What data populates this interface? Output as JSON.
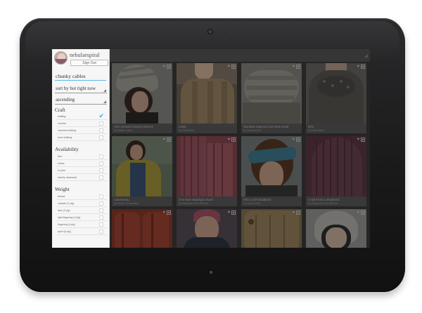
{
  "user": {
    "name": "nebulaespiral",
    "sign_out_label": "Sign Out"
  },
  "search": {
    "value": "chunky cables"
  },
  "sort": {
    "value": "sort by hot right now"
  },
  "order": {
    "value": "ascending"
  },
  "filters": [
    {
      "title": "Craft",
      "options": [
        {
          "label": "knitting",
          "checked": true
        },
        {
          "label": "crochet",
          "checked": false
        },
        {
          "label": "machine knitting",
          "checked": false
        },
        {
          "label": "loom knitting",
          "checked": false
        }
      ]
    },
    {
      "title": "Availability",
      "options": [
        {
          "label": "free",
          "checked": false
        },
        {
          "label": "online",
          "checked": false
        },
        {
          "label": "in print",
          "checked": false
        },
        {
          "label": "ravelry download",
          "checked": false
        }
      ]
    },
    {
      "title": "Weight",
      "options": [
        {
          "label": "thread",
          "checked": false
        },
        {
          "label": "cobweb (1 ply)",
          "checked": false
        },
        {
          "label": "lace (2 ply)",
          "checked": false
        },
        {
          "label": "light fingering (3 ply)",
          "checked": false
        },
        {
          "label": "fingering (4 ply)",
          "checked": false
        },
        {
          "label": "sport (5 ply)",
          "checked": false
        }
      ]
    }
  ],
  "patterns": [
    {
      "title": "Yarn Grooved Slouchy Beanie",
      "author": "by Natalie Larson"
    },
    {
      "title": "Andie",
      "author": "by Cirilia Rose"
    },
    {
      "title": "Rainbow Inspired Cowl Neck Scarf",
      "author": "by Jolanda Roch"
    },
    {
      "title": "Idris",
      "author": "by Kate Davies"
    },
    {
      "title": "Calorimetry",
      "author": "by Kathryn Schoendorf"
    },
    {
      "title": "One Row Handspun Scarf",
      "author": "by Stephanie Pearl-McPhee"
    },
    {
      "title": "Wine Leaf Headband",
      "author": "by Hanna Kemp"
    },
    {
      "title": "A Hat Fit for a Boyfriend",
      "author": "by Stephanie Pearl-McPhee"
    },
    {
      "title": "",
      "author": ""
    },
    {
      "title": "",
      "author": ""
    },
    {
      "title": "",
      "author": ""
    },
    {
      "title": "",
      "author": ""
    }
  ],
  "colors": {
    "accent": "#3aa7e0",
    "panel_bg": "#f6f6f6",
    "grid_bg": "#3d3d3d",
    "tablet": "#1a1a1b"
  },
  "icons": {
    "heart": "heart-icon",
    "collect": "add-to-queue-icon",
    "check": "checkmark-icon",
    "dropdown": "dropdown-corner-icon"
  }
}
